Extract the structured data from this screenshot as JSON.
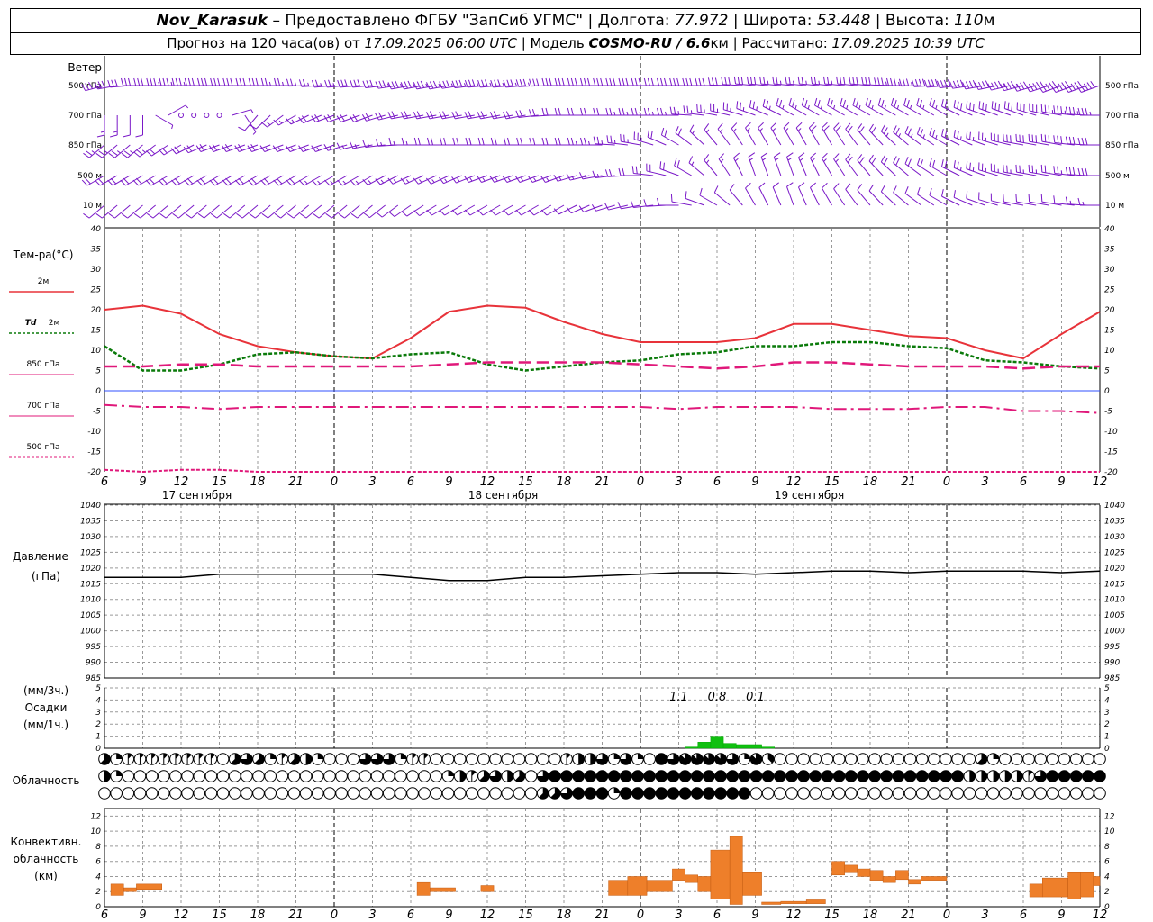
{
  "header": {
    "station": "Nov_Karasuk",
    "provider": "– Предоставлено ФГБУ \"ЗапСиб УГМС\"",
    "lon_label": "Долгота:",
    "lon": "77.972",
    "lat_label": "Широта:",
    "lat": "53.448",
    "alt_label": "Высота:",
    "alt": "110",
    "alt_unit": "м",
    "forecast_prefix": "Прогноз на 120 часа(ов) от",
    "forecast_time": "17.09.2025 06:00 UTC",
    "model_label": "Модель",
    "model": "COSMO-RU / 6.6",
    "model_unit": "км",
    "computed_label": "Рассчитано:",
    "computed_time": "17.09.2025 10:39 UTC"
  },
  "labels": {
    "wind": "Ветер",
    "wind_levels": [
      "500 гПа",
      "700 гПа",
      "850 гПа",
      "500 м",
      "10  м"
    ],
    "temp_title": "Тем-ра(°C)",
    "t2m": "2м",
    "td_sym": "Td",
    "td_lvl": "2м",
    "t850": "850 гПа",
    "t700": "700 гПа",
    "t500": "500 гПа",
    "pressure_title": "Давление",
    "pressure_unit": "(гПа)",
    "precip_unit_top": "(мм/3ч.)",
    "precip_title": "Осадки",
    "precip_unit_bottom": "(мм/1ч.)",
    "cloud_title": "Облачность",
    "conv_line1": "Конвективн.",
    "conv_line2": "облачность",
    "conv_unit": "(км)"
  },
  "colors": {
    "t2m": "#e8333a",
    "td2m": "#0a7a0a",
    "t850": "#e0187a",
    "t700": "#e0187a",
    "t500": "#e0187a",
    "wind": "#7a18c8",
    "precip": "#10c010",
    "conv": "#ee7f2a",
    "zero_line": "#3050ff"
  },
  "x_axis": {
    "hour_ticks": [
      "6",
      "9",
      "12",
      "15",
      "18",
      "21",
      "0",
      "3",
      "6",
      "9",
      "12",
      "15",
      "18",
      "21",
      "0",
      "3",
      "6",
      "9",
      "12",
      "15",
      "18",
      "21",
      "0",
      "3",
      "6",
      "9",
      "12"
    ],
    "days": [
      "17 сентября",
      "18 сентября",
      "19 сентября"
    ]
  },
  "chart_data": [
    {
      "type": "line",
      "title": "Тем-ра(°C)",
      "ylim": [
        -20,
        40
      ],
      "y_ticks": [
        "-20",
        "-15",
        "-10",
        "-5",
        "0",
        "5",
        "10",
        "15",
        "20",
        "25",
        "30",
        "35",
        "40"
      ],
      "x_hours": [
        0,
        3,
        6,
        9,
        12,
        15,
        18,
        21,
        24,
        27,
        30,
        33,
        36,
        39,
        42,
        45,
        48,
        51,
        54,
        57,
        60,
        63,
        66,
        69,
        72,
        75,
        78
      ],
      "series": [
        {
          "name": "2м",
          "values": [
            20,
            21,
            19,
            14,
            11,
            9.5,
            8.5,
            8,
            13,
            19.5,
            21,
            20.5,
            17,
            14,
            12,
            12,
            12,
            13,
            16.5,
            16.5,
            15,
            13.5,
            13,
            10,
            8,
            14,
            19.5
          ]
        },
        {
          "name": "Td 2м",
          "values": [
            11,
            5,
            5,
            6.5,
            9,
            9.5,
            8.5,
            8,
            9,
            9.5,
            6.5,
            5,
            6,
            7,
            7.5,
            9,
            9.5,
            11,
            11,
            12,
            12,
            11,
            10.5,
            7.5,
            7,
            6,
            5.5
          ]
        },
        {
          "name": "850 гПа",
          "values": [
            6,
            6,
            6.5,
            6.5,
            6,
            6,
            6,
            6,
            6,
            6.5,
            7,
            7,
            7,
            7,
            6.5,
            6,
            5.5,
            6,
            7,
            7,
            6.5,
            6,
            6,
            6,
            5.5,
            6,
            6
          ]
        },
        {
          "name": "700 гПа",
          "values": [
            -3.5,
            -4,
            -4,
            -4.5,
            -4,
            -4,
            -4,
            -4,
            -4,
            -4,
            -4,
            -4,
            -4,
            -4,
            -4,
            -4.5,
            -4,
            -4,
            -4,
            -4.5,
            -4.5,
            -4.5,
            -4,
            -4,
            -5,
            -5,
            -5.5
          ]
        },
        {
          "name": "500 гПа",
          "values": [
            -19.5,
            -20,
            -19.5,
            -19.5,
            -20,
            -20,
            -20,
            -20,
            -20,
            -20,
            -20,
            -20,
            -20,
            -20,
            -20,
            -20,
            -20,
            -20,
            -20,
            -20,
            -20,
            -20,
            -20,
            -20,
            -20,
            -20,
            -20
          ]
        }
      ]
    },
    {
      "type": "line",
      "title": "Давление",
      "ylabel": "(гПа)",
      "ylim": [
        985,
        1040
      ],
      "y_ticks": [
        "985",
        "990",
        "995",
        "1000",
        "1005",
        "1010",
        "1015",
        "1020",
        "1025",
        "1030",
        "1035",
        "1040"
      ],
      "x_hours": [
        0,
        3,
        6,
        9,
        12,
        15,
        18,
        21,
        24,
        27,
        30,
        33,
        36,
        39,
        42,
        45,
        48,
        51,
        54,
        57,
        60,
        63,
        66,
        69,
        72,
        75,
        78
      ],
      "values": [
        1017,
        1017,
        1017,
        1018,
        1018,
        1018,
        1018,
        1018,
        1017,
        1016,
        1016,
        1017,
        1017,
        1017.5,
        1018,
        1018.5,
        1018.5,
        1018,
        1018.5,
        1019,
        1019,
        1018.5,
        1019,
        1019,
        1019,
        1018.5,
        1019
      ]
    },
    {
      "type": "bar",
      "title": "Осадки",
      "ylim": [
        0,
        5
      ],
      "y_ticks": [
        "0",
        "1",
        "2",
        "3",
        "4",
        "5"
      ],
      "labels_3h": [
        "1.1",
        "0.8",
        "0.1"
      ],
      "x_hours": [
        46,
        47,
        48,
        49,
        50,
        51,
        52
      ],
      "values": [
        0.1,
        0.5,
        1.0,
        0.4,
        0.3,
        0.3,
        0.1
      ]
    },
    {
      "type": "bar",
      "title": "Конвективн. облачность",
      "ylabel": "(км)",
      "ylim": [
        0,
        13
      ],
      "y_ticks": [
        "0",
        "2",
        "4",
        "6",
        "8",
        "10",
        "12"
      ],
      "layers": [
        {
          "h0": 0.5,
          "h1": 1.5,
          "bot": 1.5,
          "top": 3
        },
        {
          "h0": 1.5,
          "h1": 2.5,
          "bot": 2,
          "top": 2.5
        },
        {
          "h0": 2.5,
          "h1": 4.5,
          "bot": 2.3,
          "top": 3
        },
        {
          "h0": 24.5,
          "h1": 25.5,
          "bot": 1.5,
          "top": 3.2
        },
        {
          "h0": 25.5,
          "h1": 27.5,
          "bot": 2,
          "top": 2.5
        },
        {
          "h0": 29.5,
          "h1": 30.5,
          "bot": 2,
          "top": 2.8
        },
        {
          "h0": 39.5,
          "h1": 41,
          "bot": 1.5,
          "top": 3.5
        },
        {
          "h0": 41,
          "h1": 42.5,
          "bot": 1.5,
          "top": 4
        },
        {
          "h0": 42.5,
          "h1": 44.5,
          "bot": 2,
          "top": 3.5
        },
        {
          "h0": 44.5,
          "h1": 45.5,
          "bot": 3.5,
          "top": 5
        },
        {
          "h0": 45.5,
          "h1": 46.5,
          "bot": 3.2,
          "top": 4.2
        },
        {
          "h0": 46.5,
          "h1": 47.5,
          "bot": 2,
          "top": 4
        },
        {
          "h0": 47.5,
          "h1": 49,
          "bot": 1,
          "top": 7.5
        },
        {
          "h0": 49,
          "h1": 50,
          "bot": 0.3,
          "top": 9.3
        },
        {
          "h0": 50,
          "h1": 51.5,
          "bot": 1.5,
          "top": 4.5
        },
        {
          "h0": 51.5,
          "h1": 53,
          "bot": 0.3,
          "top": 0.6
        },
        {
          "h0": 53,
          "h1": 55,
          "bot": 0.4,
          "top": 0.7
        },
        {
          "h0": 55,
          "h1": 56.5,
          "bot": 0.4,
          "top": 0.9
        },
        {
          "h0": 57,
          "h1": 58,
          "bot": 4.2,
          "top": 6
        },
        {
          "h0": 58,
          "h1": 59,
          "bot": 4.5,
          "top": 5.5
        },
        {
          "h0": 59,
          "h1": 60,
          "bot": 4,
          "top": 5
        },
        {
          "h0": 60,
          "h1": 61,
          "bot": 3.5,
          "top": 4.8
        },
        {
          "h0": 61,
          "h1": 62,
          "bot": 3.2,
          "top": 4
        },
        {
          "h0": 62,
          "h1": 63,
          "bot": 3.6,
          "top": 4.8
        },
        {
          "h0": 63,
          "h1": 64,
          "bot": 3,
          "top": 3.6
        },
        {
          "h0": 64,
          "h1": 66,
          "bot": 3.5,
          "top": 4
        },
        {
          "h0": 72.5,
          "h1": 73.5,
          "bot": 1.3,
          "top": 3
        },
        {
          "h0": 73.5,
          "h1": 75.5,
          "bot": 1.3,
          "top": 3.8
        },
        {
          "h0": 75.5,
          "h1": 76.5,
          "bot": 1,
          "top": 4.5
        },
        {
          "h0": 76.5,
          "h1": 77.5,
          "bot": 1.3,
          "top": 4.5
        },
        {
          "h0": 77.5,
          "h1": 78,
          "bot": 2.8,
          "top": 4
        }
      ]
    }
  ],
  "clouds": {
    "rows": [
      [
        5,
        2,
        1,
        1,
        1,
        1,
        1,
        1,
        1,
        1,
        0,
        5,
        6,
        5,
        2,
        1,
        5,
        4,
        2,
        0,
        0,
        0,
        6,
        6,
        6,
        2,
        1,
        1,
        0,
        0,
        0,
        0,
        0,
        0,
        0,
        0,
        0,
        0,
        0,
        1,
        4,
        4,
        6,
        2,
        6,
        2,
        0,
        8,
        6,
        7,
        7,
        7,
        7,
        6,
        2,
        7,
        3,
        0,
        0,
        0,
        0,
        0,
        0,
        0,
        0,
        0,
        0,
        0,
        0,
        0,
        0,
        0,
        0,
        0,
        5,
        2,
        0,
        0,
        0,
        0,
        0,
        0,
        0,
        0,
        0
      ],
      [
        4,
        2,
        0,
        0,
        0,
        0,
        0,
        0,
        0,
        0,
        0,
        0,
        0,
        0,
        0,
        0,
        0,
        0,
        0,
        0,
        0,
        0,
        0,
        0,
        0,
        0,
        0,
        0,
        0,
        2,
        4,
        1,
        5,
        6,
        4,
        5,
        0,
        6,
        8,
        8,
        8,
        8,
        8,
        8,
        8,
        8,
        8,
        8,
        8,
        8,
        8,
        8,
        8,
        8,
        8,
        8,
        8,
        8,
        8,
        8,
        8,
        8,
        8,
        8,
        8,
        8,
        8,
        8,
        8,
        8,
        8,
        8,
        8,
        4,
        4,
        4,
        4,
        4,
        1,
        6,
        8,
        8,
        8,
        8,
        8
      ],
      [
        0,
        0,
        0,
        0,
        0,
        0,
        0,
        0,
        0,
        0,
        0,
        0,
        0,
        0,
        0,
        0,
        0,
        0,
        0,
        0,
        0,
        0,
        0,
        0,
        0,
        0,
        0,
        0,
        0,
        0,
        0,
        0,
        0,
        0,
        0,
        0,
        0,
        5,
        5,
        6,
        8,
        8,
        8,
        2,
        8,
        8,
        8,
        8,
        8,
        8,
        8,
        8,
        8,
        8,
        8,
        0,
        0,
        0,
        0,
        0,
        0,
        0,
        0,
        0,
        0,
        0,
        0,
        0,
        0,
        0,
        0,
        0,
        0,
        0,
        0,
        0,
        0,
        0,
        0,
        0,
        0,
        0,
        0,
        0,
        0
      ]
    ]
  },
  "wind": {
    "dir_500hPa": [
      255,
      270,
      270,
      270,
      270,
      270,
      265,
      265,
      260,
      260,
      265,
      265,
      270,
      270,
      270,
      270,
      270,
      275,
      275,
      275,
      275,
      270,
      265,
      260,
      255,
      250,
      250
    ],
    "speed_500hPa": [
      30,
      30,
      35,
      30,
      30,
      25,
      25,
      30,
      35,
      35,
      35,
      35,
      30,
      30,
      30,
      30,
      30,
      30,
      25,
      25,
      30,
      35,
      40,
      40,
      45,
      50,
      50
    ],
    "dir_700hPa": [
      180,
      180,
      0,
      0,
      220,
      240,
      250,
      250,
      260,
      260,
      260,
      260,
      270,
      270,
      270,
      270,
      280,
      290,
      300,
      300,
      300,
      300,
      300,
      290,
      290,
      280,
      270
    ],
    "speed_700hPa": [
      15,
      10,
      0,
      0,
      10,
      15,
      20,
      20,
      20,
      20,
      20,
      20,
      20,
      20,
      25,
      25,
      25,
      25,
      25,
      25,
      25,
      25,
      25,
      30,
      30,
      35,
      35
    ],
    "dir_850hPa": [
      230,
      230,
      240,
      250,
      250,
      250,
      250,
      260,
      270,
      270,
      270,
      270,
      270,
      270,
      280,
      300,
      320,
      330,
      330,
      330,
      320,
      310,
      300,
      290,
      280,
      280,
      270
    ],
    "speed_850hPa": [
      25,
      25,
      20,
      20,
      20,
      15,
      15,
      15,
      15,
      20,
      20,
      20,
      20,
      25,
      25,
      20,
      15,
      15,
      15,
      20,
      20,
      25,
      25,
      25,
      30,
      30,
      30
    ],
    "dir_500m": [
      240,
      240,
      240,
      240,
      240,
      240,
      240,
      240,
      245,
      245,
      250,
      250,
      250,
      260,
      270,
      290,
      320,
      340,
      340,
      330,
      320,
      310,
      300,
      290,
      280,
      280,
      270
    ],
    "speed_500m": [
      20,
      20,
      20,
      20,
      20,
      20,
      15,
      15,
      15,
      15,
      15,
      15,
      15,
      15,
      20,
      20,
      15,
      15,
      15,
      15,
      20,
      20,
      20,
      25,
      25,
      25,
      30
    ],
    "dir_10m": [
      230,
      230,
      230,
      230,
      230,
      230,
      230,
      230,
      235,
      240,
      240,
      240,
      240,
      250,
      260,
      270,
      300,
      330,
      340,
      330,
      320,
      310,
      300,
      290,
      280,
      280,
      270
    ],
    "speed_10m": [
      10,
      10,
      10,
      10,
      10,
      10,
      10,
      10,
      10,
      10,
      10,
      10,
      10,
      10,
      10,
      10,
      10,
      10,
      10,
      10,
      10,
      10,
      10,
      10,
      10,
      10,
      15
    ]
  }
}
